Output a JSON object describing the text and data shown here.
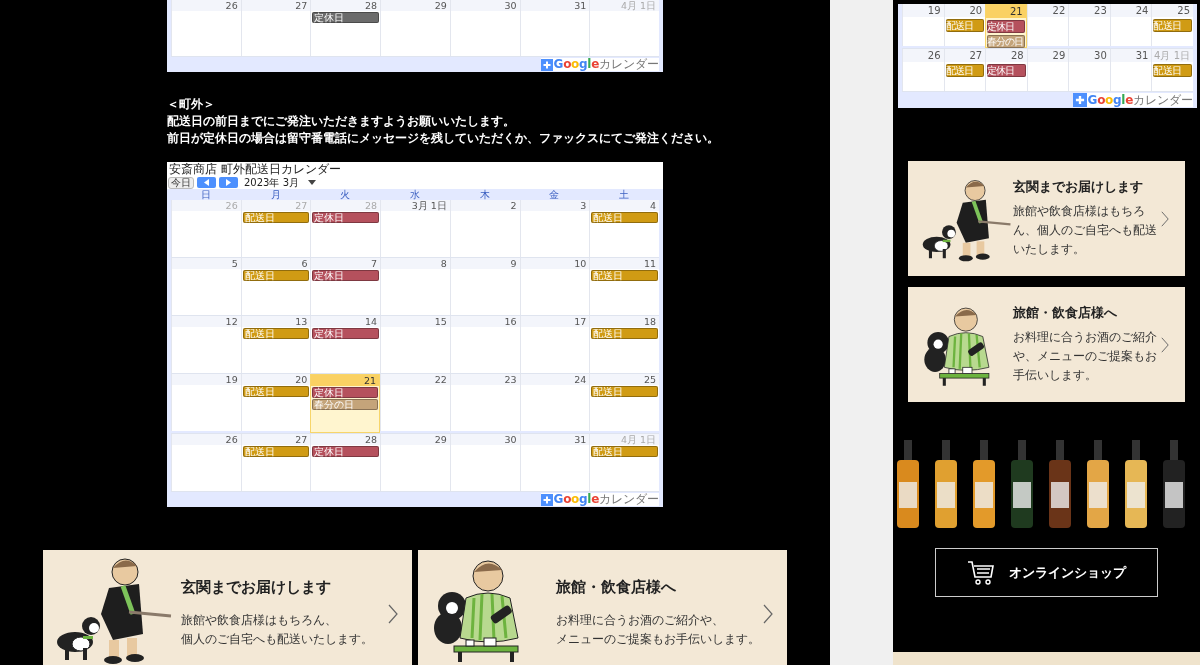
{
  "top_calendar": {
    "weeks": [
      {
        "days": [
          {
            "date": "26",
            "muted": false,
            "today": false
          },
          {
            "date": "27",
            "muted": false,
            "today": false
          },
          {
            "date": "28",
            "muted": false,
            "today": false,
            "events": [
              {
                "label": "定休日",
                "color": "#6b6b6b"
              }
            ]
          },
          {
            "date": "29",
            "muted": false,
            "today": false
          },
          {
            "date": "30",
            "muted": false,
            "today": false
          },
          {
            "date": "31",
            "muted": false,
            "today": false
          },
          {
            "date": "4月 1日",
            "muted": true,
            "today": false
          }
        ]
      }
    ],
    "footer": {
      "brand": "Google",
      "label": "カレンダー"
    }
  },
  "note": {
    "heading": "＜町外＞",
    "lines": [
      "配送日の前日までにご発注いただきますようお願いいたします。",
      "前日が定休日の場合は留守番電話にメッセージを残していただくか、ファックスにてご発注ください。"
    ]
  },
  "calendar": {
    "title": "安斎商店 町外配送日カレンダー",
    "today_button": "今日",
    "month": "2023年 3月",
    "weekdays": [
      "日",
      "月",
      "火",
      "水",
      "木",
      "金",
      "土"
    ],
    "weeks": [
      {
        "days": [
          {
            "date": "26",
            "muted": true,
            "today": false
          },
          {
            "date": "27",
            "muted": true,
            "today": false,
            "events": [
              {
                "label": "配送日",
                "color": "#d09b14"
              }
            ]
          },
          {
            "date": "28",
            "muted": true,
            "today": false,
            "events": [
              {
                "label": "定休日",
                "color": "#b5515d"
              }
            ]
          },
          {
            "date": "3月 1日",
            "muted": false,
            "today": false
          },
          {
            "date": "2",
            "muted": false,
            "today": false
          },
          {
            "date": "3",
            "muted": false,
            "today": false
          },
          {
            "date": "4",
            "muted": false,
            "today": false,
            "events": [
              {
                "label": "配送日",
                "color": "#d09b14"
              }
            ]
          }
        ]
      },
      {
        "days": [
          {
            "date": "5",
            "muted": false,
            "today": false
          },
          {
            "date": "6",
            "muted": false,
            "today": false,
            "events": [
              {
                "label": "配送日",
                "color": "#d09b14"
              }
            ]
          },
          {
            "date": "7",
            "muted": false,
            "today": false,
            "events": [
              {
                "label": "定休日",
                "color": "#b5515d"
              }
            ]
          },
          {
            "date": "8",
            "muted": false,
            "today": false
          },
          {
            "date": "9",
            "muted": false,
            "today": false
          },
          {
            "date": "10",
            "muted": false,
            "today": false
          },
          {
            "date": "11",
            "muted": false,
            "today": false,
            "events": [
              {
                "label": "配送日",
                "color": "#d09b14"
              }
            ]
          }
        ]
      },
      {
        "days": [
          {
            "date": "12",
            "muted": false,
            "today": false
          },
          {
            "date": "13",
            "muted": false,
            "today": false,
            "events": [
              {
                "label": "配送日",
                "color": "#d09b14"
              }
            ]
          },
          {
            "date": "14",
            "muted": false,
            "today": false,
            "events": [
              {
                "label": "定休日",
                "color": "#b5515d"
              }
            ]
          },
          {
            "date": "15",
            "muted": false,
            "today": false
          },
          {
            "date": "16",
            "muted": false,
            "today": false
          },
          {
            "date": "17",
            "muted": false,
            "today": false
          },
          {
            "date": "18",
            "muted": false,
            "today": false,
            "events": [
              {
                "label": "配送日",
                "color": "#d09b14"
              }
            ]
          }
        ]
      },
      {
        "days": [
          {
            "date": "19",
            "muted": false,
            "today": false
          },
          {
            "date": "20",
            "muted": false,
            "today": false,
            "events": [
              {
                "label": "配送日",
                "color": "#d09b14"
              }
            ]
          },
          {
            "date": "21",
            "muted": false,
            "today": true,
            "events": [
              {
                "label": "定休日",
                "color": "#b5515d"
              },
              {
                "label": "春分の日",
                "color": "#c4a47a"
              }
            ]
          },
          {
            "date": "22",
            "muted": false,
            "today": false
          },
          {
            "date": "23",
            "muted": false,
            "today": false
          },
          {
            "date": "24",
            "muted": false,
            "today": false
          },
          {
            "date": "25",
            "muted": false,
            "today": false,
            "events": [
              {
                "label": "配送日",
                "color": "#d09b14"
              }
            ]
          }
        ]
      },
      {
        "days": [
          {
            "date": "26",
            "muted": false,
            "today": false
          },
          {
            "date": "27",
            "muted": false,
            "today": false,
            "events": [
              {
                "label": "配送日",
                "color": "#d09b14"
              }
            ]
          },
          {
            "date": "28",
            "muted": false,
            "today": false,
            "events": [
              {
                "label": "定休日",
                "color": "#b5515d"
              }
            ]
          },
          {
            "date": "29",
            "muted": false,
            "today": false
          },
          {
            "date": "30",
            "muted": false,
            "today": false
          },
          {
            "date": "31",
            "muted": false,
            "today": false
          },
          {
            "date": "4月 1日",
            "muted": true,
            "today": false,
            "events": [
              {
                "label": "配送日",
                "color": "#d09b14"
              }
            ]
          }
        ]
      }
    ],
    "footer": {
      "brand": "Google",
      "label": "カレンダー"
    }
  },
  "feature_cards": [
    {
      "kind": "walking",
      "title": "玄関までお届けします",
      "lines": [
        "旅館や飲食店様はもちろん、",
        "個人のご自宅へも配送いたします。"
      ]
    },
    {
      "kind": "seated",
      "title": "旅館・飲食店様へ",
      "lines": [
        "お料理に合うお酒のご紹介や、",
        "メニューのご提案もお手伝いします。"
      ]
    }
  ],
  "sidebar": {
    "calendar": {
      "weeks": [
        {
          "days": [
            {
              "date": "19",
              "muted": false,
              "today": false
            },
            {
              "date": "20",
              "muted": false,
              "today": false,
              "events": [
                {
                  "label": "配送日",
                  "color": "#d09b14"
                }
              ]
            },
            {
              "date": "21",
              "muted": false,
              "today": true,
              "events": [
                {
                  "label": "定休日",
                  "color": "#b5515d"
                },
                {
                  "label": "春分の日",
                  "color": "#c4a47a"
                }
              ]
            },
            {
              "date": "22",
              "muted": false,
              "today": false
            },
            {
              "date": "23",
              "muted": false,
              "today": false
            },
            {
              "date": "24",
              "muted": false,
              "today": false
            },
            {
              "date": "25",
              "muted": false,
              "today": false,
              "events": [
                {
                  "label": "配送日",
                  "color": "#d09b14"
                }
              ]
            }
          ]
        },
        {
          "days": [
            {
              "date": "26",
              "muted": false,
              "today": false
            },
            {
              "date": "27",
              "muted": false,
              "today": false,
              "events": [
                {
                  "label": "配送日",
                  "color": "#d09b14"
                }
              ]
            },
            {
              "date": "28",
              "muted": false,
              "today": false,
              "events": [
                {
                  "label": "定休日",
                  "color": "#b5515d"
                }
              ]
            },
            {
              "date": "29",
              "muted": false,
              "today": false
            },
            {
              "date": "30",
              "muted": false,
              "today": false
            },
            {
              "date": "31",
              "muted": false,
              "today": false
            },
            {
              "date": "4月 1日",
              "muted": true,
              "today": false,
              "events": [
                {
                  "label": "配送日",
                  "color": "#d09b14"
                }
              ]
            }
          ]
        }
      ],
      "footer": {
        "brand": "Google",
        "label": "カレンダー"
      }
    },
    "cards": [
      {
        "kind": "walking",
        "title": "玄関までお届けします",
        "text": "旅館や飲食店様はもちろん、個人のご自宅へも配送いたします。"
      },
      {
        "kind": "seated",
        "title": "旅館・飲食店様へ",
        "text": "お料理に合うお酒のご紹介や、メニューのご提案もお手伝いします。"
      }
    ],
    "shop_button": "オンラインショップ"
  }
}
